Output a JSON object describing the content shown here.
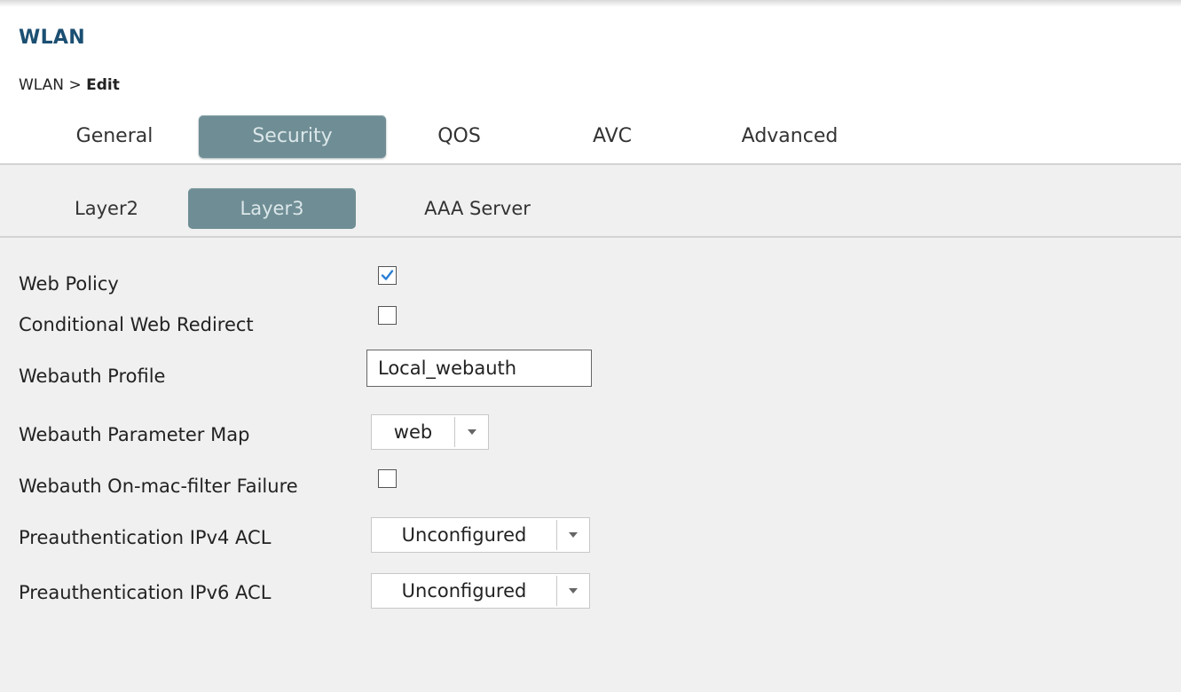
{
  "header": {
    "title": "WLAN",
    "breadcrumb": {
      "parent": "WLAN",
      "separator": ">",
      "current": "Edit"
    }
  },
  "tabs": [
    {
      "label": "General",
      "active": false
    },
    {
      "label": "Security",
      "active": true
    },
    {
      "label": "QOS",
      "active": false
    },
    {
      "label": "AVC",
      "active": false
    },
    {
      "label": "Advanced",
      "active": false
    }
  ],
  "subtabs": [
    {
      "label": "Layer2",
      "active": false
    },
    {
      "label": "Layer3",
      "active": true
    },
    {
      "label": "AAA Server",
      "active": false
    }
  ],
  "form": {
    "web_policy": {
      "label": "Web Policy",
      "checked": true
    },
    "conditional_web_redirect": {
      "label": "Conditional Web Redirect",
      "checked": false
    },
    "webauth_profile": {
      "label": "Webauth Profile",
      "value": "Local_webauth"
    },
    "webauth_parameter_map": {
      "label": "Webauth Parameter Map",
      "value": "web"
    },
    "webauth_on_mac_filter_failure": {
      "label": "Webauth On-mac-filter Failure",
      "checked": false
    },
    "preauth_ipv4_acl": {
      "label": "Preauthentication IPv4 ACL",
      "value": "Unconfigured"
    },
    "preauth_ipv6_acl": {
      "label": "Preauthentication IPv6 ACL",
      "value": "Unconfigured"
    }
  },
  "icons": {
    "checkmark": "check-icon",
    "dropdown": "chevron-down-icon"
  },
  "colors": {
    "title": "#1b4f72",
    "active_tab_bg": "#6f8d94",
    "active_tab_text": "#dbe7ea",
    "checkmark": "#2a7fd4",
    "page_bg": "#f0f0f0"
  }
}
